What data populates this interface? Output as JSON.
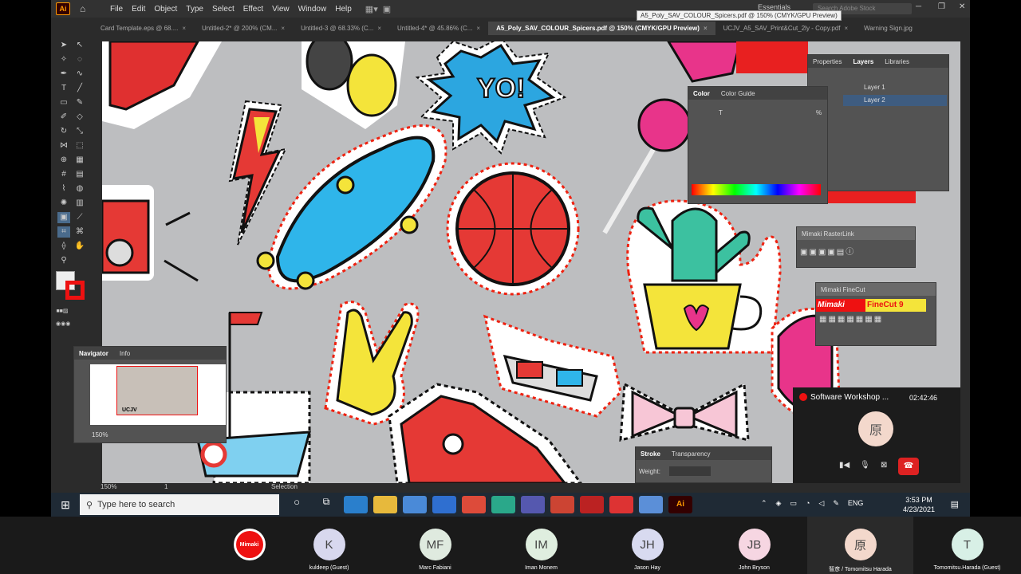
{
  "menubar": {
    "app_icon": "Ai",
    "menus": [
      "File",
      "Edit",
      "Object",
      "Type",
      "Select",
      "Effect",
      "View",
      "Window",
      "Help"
    ],
    "workspace": "Essentials",
    "search_placeholder": "Search Adobe Stock"
  },
  "tabs": [
    {
      "label": "Card Template.eps @ 68....",
      "active": false
    },
    {
      "label": "Untitled-2* @ 200% (CM...",
      "active": false
    },
    {
      "label": "Untitled-3 @ 68.33% (C...",
      "active": false
    },
    {
      "label": "Untitled-4* @ 45.86% (C...",
      "active": false
    },
    {
      "label": "A5_Poly_SAV_COLOUR_Spicers.pdf @ 150% (CMYK/GPU Preview)",
      "active": true
    },
    {
      "label": "UCJV_A5_SAV_Print&Cut_2ly - Copy.pdf",
      "active": false
    },
    {
      "label": "Warning Sign.jpg",
      "active": false
    }
  ],
  "tooltip": "A5_Poly_SAV_COLOUR_Spicers.pdf @ 150% (CMYK/GPU Preview)",
  "color_panel": {
    "tabs": [
      "Color",
      "Color Guide"
    ],
    "channel": "T",
    "unit": "%"
  },
  "layers_panel": {
    "tabs": [
      "Properties",
      "Layers",
      "Libraries"
    ],
    "layers": [
      "Layer 1",
      "Layer 2"
    ]
  },
  "rasterlink": {
    "title": "Mimaki RasterLink"
  },
  "finecut": {
    "title": "Mimaki FineCut",
    "logo": "Mimaki",
    "product": "FineCut 9"
  },
  "navigator": {
    "tabs": [
      "Navigator",
      "Info"
    ],
    "zoom": "150%",
    "thumb_logo": "UCJV"
  },
  "stroke_panel": {
    "tabs": [
      "Stroke",
      "Transparency"
    ],
    "weight_label": "Weight:"
  },
  "statusbar": {
    "zoom": "150%",
    "page": "1",
    "tool": "Selection"
  },
  "taskbar": {
    "search": "Type here to search",
    "time": "3:53 PM",
    "date": "4/23/2021",
    "lang": "ENG"
  },
  "zoom_mini": {
    "title": "Software Workshop ...",
    "elapsed": "02:42:46",
    "avatar": "原"
  },
  "participants": [
    {
      "initials": "",
      "name": "",
      "color": "#ffffff",
      "logo": "Mimaki"
    },
    {
      "initials": "K",
      "name": "kuldeep (Guest)",
      "color": "#d8d8ee"
    },
    {
      "initials": "MF",
      "name": "Marc Fabiani",
      "color": "#dfeadf"
    },
    {
      "initials": "IM",
      "name": "Iman Monem",
      "color": "#dfeedf"
    },
    {
      "initials": "JH",
      "name": "Jason Hay",
      "color": "#d8daf0"
    },
    {
      "initials": "JB",
      "name": "John Bryson",
      "color": "#f6d6e2"
    },
    {
      "initials": "原",
      "name": "智彦 / Tomomitsu Harada",
      "color": "#f3d8cc"
    },
    {
      "initials": "T",
      "name": "Tomomitsu.Harada (Guest)",
      "color": "#d8f0e6"
    }
  ]
}
